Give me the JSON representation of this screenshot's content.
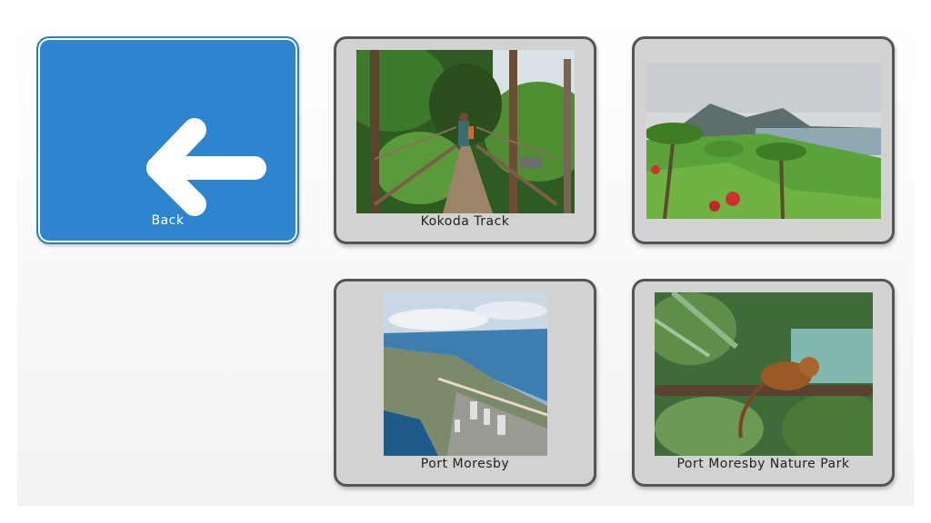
{
  "back_tile": {
    "label": "Back",
    "color": "#2d85cf"
  },
  "tiles": [
    {
      "label": "Kokoda Track",
      "image": "jungle-suspension-bridge-photo"
    },
    {
      "label": "",
      "image": "tropical-coast-palm-trees-photo"
    },
    {
      "label": "Port Moresby",
      "image": "aerial-city-coast-photo"
    },
    {
      "label": "Port Moresby Nature Park",
      "image": "tree-kangaroo-photo"
    }
  ]
}
